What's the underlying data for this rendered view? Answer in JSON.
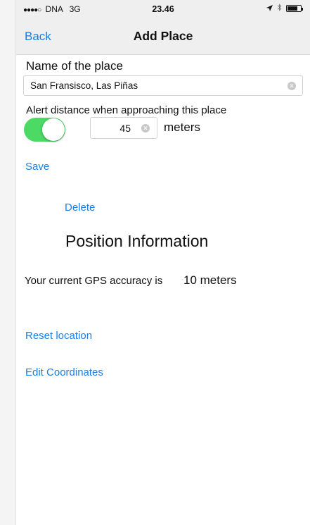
{
  "status_bar": {
    "signal_dots": "●●●●○",
    "carrier": "DNA",
    "network": "3G",
    "time": "23.46",
    "location_icon": "location-arrow-icon",
    "bluetooth_icon": "bluetooth-icon",
    "battery_icon": "battery-icon",
    "battery_level": 0.75
  },
  "nav": {
    "back_label": "Back",
    "title": "Add Place"
  },
  "form": {
    "name_label": "Name of the place",
    "name_value": "San Fransisco, Las Piñas",
    "alert_label": "Alert distance when approaching this place",
    "alert_enabled": true,
    "distance_value": "45",
    "unit_label": "meters",
    "save_label": "Save",
    "delete_label": "Delete"
  },
  "position": {
    "section_title": "Position Information",
    "gps_label": "Your current GPS accuracy is",
    "gps_value": "10 meters",
    "reset_label": "Reset location",
    "edit_label": "Edit Coordinates"
  },
  "colors": {
    "accent": "#1a7ee6",
    "toggle_on": "#4cd964",
    "bar_background": "#efefef"
  }
}
